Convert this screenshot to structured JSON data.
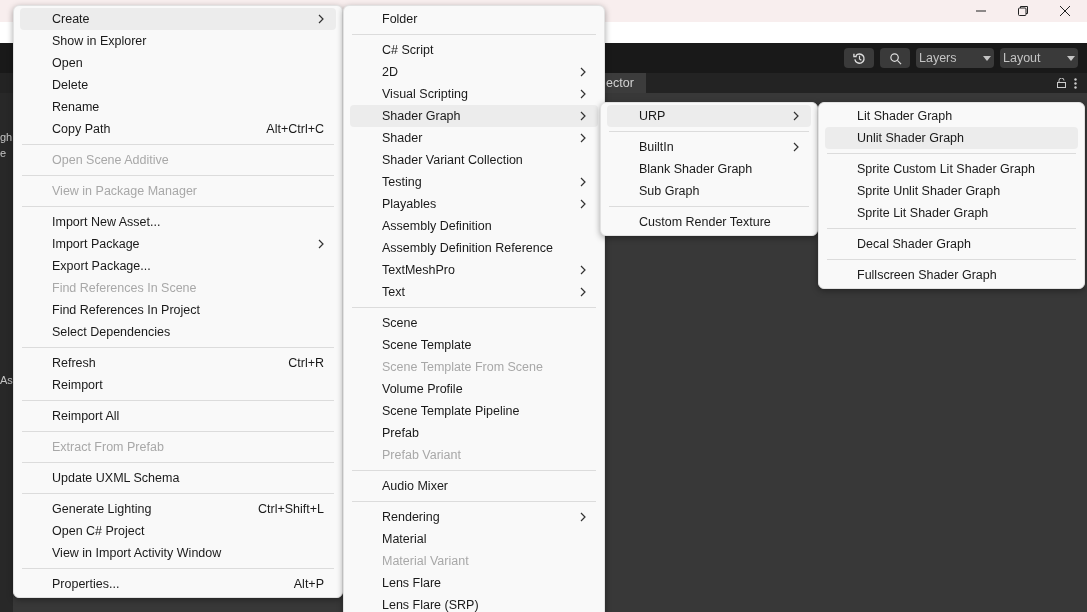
{
  "toolbar": {
    "layers": "Layers",
    "layout": "Layout"
  },
  "tab": {
    "label": "ector"
  },
  "left_fragments": [
    "gh",
    "e",
    "As"
  ],
  "menus": [
    {
      "items": [
        {
          "kind": "item",
          "label": "Create",
          "submenu": true,
          "selected": true,
          "disabled": false
        },
        {
          "kind": "item",
          "label": "Show in Explorer",
          "submenu": false,
          "selected": false,
          "disabled": false
        },
        {
          "kind": "item",
          "label": "Open",
          "submenu": false,
          "selected": false,
          "disabled": false
        },
        {
          "kind": "item",
          "label": "Delete",
          "submenu": false,
          "selected": false,
          "disabled": false
        },
        {
          "kind": "item",
          "label": "Rename",
          "submenu": false,
          "selected": false,
          "disabled": false
        },
        {
          "kind": "item",
          "label": "Copy Path",
          "shortcut": "Alt+Ctrl+C",
          "submenu": false,
          "selected": false,
          "disabled": false
        },
        {
          "kind": "separator"
        },
        {
          "kind": "item",
          "label": "Open Scene Additive",
          "submenu": false,
          "selected": false,
          "disabled": true
        },
        {
          "kind": "separator"
        },
        {
          "kind": "item",
          "label": "View in Package Manager",
          "submenu": false,
          "selected": false,
          "disabled": true
        },
        {
          "kind": "separator"
        },
        {
          "kind": "item",
          "label": "Import New Asset...",
          "submenu": false,
          "selected": false,
          "disabled": false
        },
        {
          "kind": "item",
          "label": "Import Package",
          "submenu": true,
          "selected": false,
          "disabled": false
        },
        {
          "kind": "item",
          "label": "Export Package...",
          "submenu": false,
          "selected": false,
          "disabled": false
        },
        {
          "kind": "item",
          "label": "Find References In Scene",
          "submenu": false,
          "selected": false,
          "disabled": true
        },
        {
          "kind": "item",
          "label": "Find References In Project",
          "submenu": false,
          "selected": false,
          "disabled": false
        },
        {
          "kind": "item",
          "label": "Select Dependencies",
          "submenu": false,
          "selected": false,
          "disabled": false
        },
        {
          "kind": "separator"
        },
        {
          "kind": "item",
          "label": "Refresh",
          "shortcut": "Ctrl+R",
          "submenu": false,
          "selected": false,
          "disabled": false
        },
        {
          "kind": "item",
          "label": "Reimport",
          "submenu": false,
          "selected": false,
          "disabled": false
        },
        {
          "kind": "separator"
        },
        {
          "kind": "item",
          "label": "Reimport All",
          "submenu": false,
          "selected": false,
          "disabled": false
        },
        {
          "kind": "separator"
        },
        {
          "kind": "item",
          "label": "Extract From Prefab",
          "submenu": false,
          "selected": false,
          "disabled": true
        },
        {
          "kind": "separator"
        },
        {
          "kind": "item",
          "label": "Update UXML Schema",
          "submenu": false,
          "selected": false,
          "disabled": false
        },
        {
          "kind": "separator"
        },
        {
          "kind": "item",
          "label": "Generate Lighting",
          "shortcut": "Ctrl+Shift+L",
          "submenu": false,
          "selected": false,
          "disabled": false
        },
        {
          "kind": "item",
          "label": "Open C# Project",
          "submenu": false,
          "selected": false,
          "disabled": false
        },
        {
          "kind": "item",
          "label": "View in Import Activity Window",
          "submenu": false,
          "selected": false,
          "disabled": false
        },
        {
          "kind": "separator"
        },
        {
          "kind": "item",
          "label": "Properties...",
          "shortcut": "Alt+P",
          "submenu": false,
          "selected": false,
          "disabled": false
        }
      ]
    },
    {
      "items": [
        {
          "kind": "item",
          "label": "Folder",
          "submenu": false,
          "selected": false,
          "disabled": false
        },
        {
          "kind": "separator"
        },
        {
          "kind": "item",
          "label": "C# Script",
          "submenu": false,
          "selected": false,
          "disabled": false
        },
        {
          "kind": "item",
          "label": "2D",
          "submenu": true,
          "selected": false,
          "disabled": false
        },
        {
          "kind": "item",
          "label": "Visual Scripting",
          "submenu": true,
          "selected": false,
          "disabled": false
        },
        {
          "kind": "item",
          "label": "Shader Graph",
          "submenu": true,
          "selected": true,
          "disabled": false
        },
        {
          "kind": "item",
          "label": "Shader",
          "submenu": true,
          "selected": false,
          "disabled": false
        },
        {
          "kind": "item",
          "label": "Shader Variant Collection",
          "submenu": false,
          "selected": false,
          "disabled": false
        },
        {
          "kind": "item",
          "label": "Testing",
          "submenu": true,
          "selected": false,
          "disabled": false
        },
        {
          "kind": "item",
          "label": "Playables",
          "submenu": true,
          "selected": false,
          "disabled": false
        },
        {
          "kind": "item",
          "label": "Assembly Definition",
          "submenu": false,
          "selected": false,
          "disabled": false
        },
        {
          "kind": "item",
          "label": "Assembly Definition Reference",
          "submenu": false,
          "selected": false,
          "disabled": false
        },
        {
          "kind": "item",
          "label": "TextMeshPro",
          "submenu": true,
          "selected": false,
          "disabled": false
        },
        {
          "kind": "item",
          "label": "Text",
          "submenu": true,
          "selected": false,
          "disabled": false
        },
        {
          "kind": "separator"
        },
        {
          "kind": "item",
          "label": "Scene",
          "submenu": false,
          "selected": false,
          "disabled": false
        },
        {
          "kind": "item",
          "label": "Scene Template",
          "submenu": false,
          "selected": false,
          "disabled": false
        },
        {
          "kind": "item",
          "label": "Scene Template From Scene",
          "submenu": false,
          "selected": false,
          "disabled": true
        },
        {
          "kind": "item",
          "label": "Volume Profile",
          "submenu": false,
          "selected": false,
          "disabled": false
        },
        {
          "kind": "item",
          "label": "Scene Template Pipeline",
          "submenu": false,
          "selected": false,
          "disabled": false
        },
        {
          "kind": "item",
          "label": "Prefab",
          "submenu": false,
          "selected": false,
          "disabled": false
        },
        {
          "kind": "item",
          "label": "Prefab Variant",
          "submenu": false,
          "selected": false,
          "disabled": true
        },
        {
          "kind": "separator"
        },
        {
          "kind": "item",
          "label": "Audio Mixer",
          "submenu": false,
          "selected": false,
          "disabled": false
        },
        {
          "kind": "separator"
        },
        {
          "kind": "item",
          "label": "Rendering",
          "submenu": true,
          "selected": false,
          "disabled": false
        },
        {
          "kind": "item",
          "label": "Material",
          "submenu": false,
          "selected": false,
          "disabled": false
        },
        {
          "kind": "item",
          "label": "Material Variant",
          "submenu": false,
          "selected": false,
          "disabled": true
        },
        {
          "kind": "item",
          "label": "Lens Flare",
          "submenu": false,
          "selected": false,
          "disabled": false
        },
        {
          "kind": "item",
          "label": "Lens Flare (SRP)",
          "submenu": false,
          "selected": false,
          "disabled": false
        }
      ]
    },
    {
      "items": [
        {
          "kind": "item",
          "label": "URP",
          "submenu": true,
          "selected": true,
          "disabled": false
        },
        {
          "kind": "separator"
        },
        {
          "kind": "item",
          "label": "BuiltIn",
          "submenu": true,
          "selected": false,
          "disabled": false
        },
        {
          "kind": "item",
          "label": "Blank Shader Graph",
          "submenu": false,
          "selected": false,
          "disabled": false
        },
        {
          "kind": "item",
          "label": "Sub Graph",
          "submenu": false,
          "selected": false,
          "disabled": false
        },
        {
          "kind": "separator"
        },
        {
          "kind": "item",
          "label": "Custom Render Texture",
          "submenu": false,
          "selected": false,
          "disabled": false
        }
      ]
    },
    {
      "items": [
        {
          "kind": "item",
          "label": "Lit Shader Graph",
          "submenu": false,
          "selected": false,
          "disabled": false
        },
        {
          "kind": "item",
          "label": "Unlit Shader Graph",
          "submenu": false,
          "selected": true,
          "disabled": false
        },
        {
          "kind": "separator"
        },
        {
          "kind": "item",
          "label": "Sprite Custom Lit Shader Graph",
          "submenu": false,
          "selected": false,
          "disabled": false
        },
        {
          "kind": "item",
          "label": "Sprite Unlit Shader Graph",
          "submenu": false,
          "selected": false,
          "disabled": false
        },
        {
          "kind": "item",
          "label": "Sprite Lit Shader Graph",
          "submenu": false,
          "selected": false,
          "disabled": false
        },
        {
          "kind": "separator"
        },
        {
          "kind": "item",
          "label": "Decal Shader Graph",
          "submenu": false,
          "selected": false,
          "disabled": false
        },
        {
          "kind": "separator"
        },
        {
          "kind": "item",
          "label": "Fullscreen Shader Graph",
          "submenu": false,
          "selected": false,
          "disabled": false
        }
      ]
    }
  ]
}
